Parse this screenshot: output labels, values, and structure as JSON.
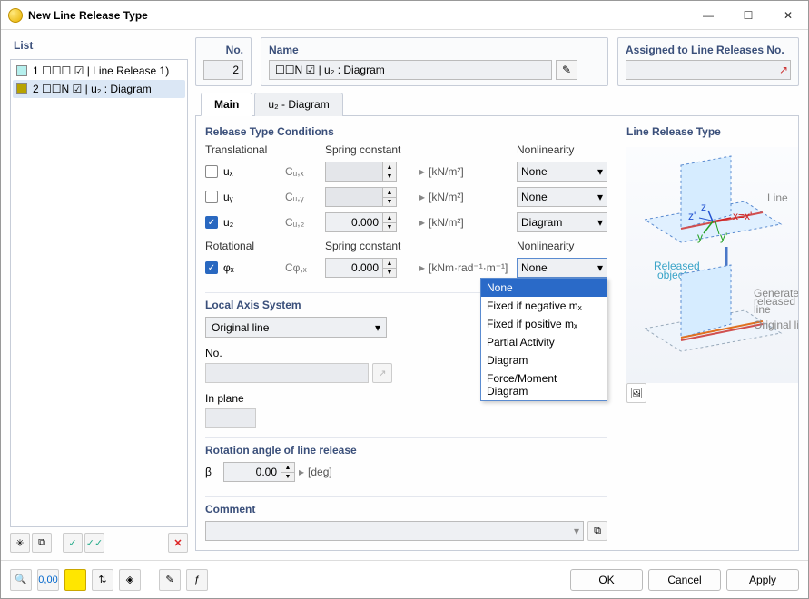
{
  "window_title": "New Line Release Type",
  "list": {
    "header": "List",
    "items": [
      {
        "swatch": "#b6f0ee",
        "label": "1  ☐☐☐ ☑ | Line Release 1)"
      },
      {
        "swatch": "#b8a300",
        "label": "2  ☐☐N ☑ | u₂ : Diagram"
      }
    ],
    "selected_index": 1
  },
  "top": {
    "no_label": "No.",
    "no_value": "2",
    "name_label": "Name",
    "name_value": "☐☐N ☑ | u₂ : Diagram",
    "assigned_label": "Assigned to Line Releases No."
  },
  "tabs": {
    "items": [
      "Main",
      "u₂ - Diagram"
    ],
    "active_index": 0
  },
  "conditions": {
    "header": "Release Type Conditions",
    "translational_label": "Translational",
    "spring_label": "Spring constant",
    "nonlinearity_label": "Nonlinearity",
    "rows_t": [
      {
        "chk": false,
        "name": "uₓ",
        "slabel": "Cᵤ,ₓ",
        "val": "",
        "unit": "[kN/m²]",
        "nl": "None"
      },
      {
        "chk": false,
        "name": "uᵧ",
        "slabel": "Cᵤ,ᵧ",
        "val": "",
        "unit": "[kN/m²]",
        "nl": "None"
      },
      {
        "chk": true,
        "name": "u₂",
        "slabel": "Cᵤ,₂",
        "val": "0.000",
        "unit": "[kN/m²]",
        "nl": "Diagram"
      }
    ],
    "rotational_label": "Rotational",
    "rows_r": [
      {
        "chk": true,
        "name": "φₓ",
        "slabel": "Cφ,ₓ",
        "val": "0.000",
        "unit": "[kNm·rad⁻¹·m⁻¹]",
        "nl": "None"
      }
    ]
  },
  "dropdown": {
    "items": [
      "None",
      "Fixed if negative mₓ",
      "Fixed if positive mₓ",
      "Partial Activity",
      "Diagram",
      "Force/Moment Diagram"
    ],
    "selected_index": 0
  },
  "local": {
    "header": "Local Axis System",
    "select_value": "Original line",
    "no_label": "No.",
    "inplane_label": "In plane"
  },
  "rotation": {
    "header": "Rotation angle of line release",
    "symbol": "β",
    "value": "0.00",
    "unit": "[deg]"
  },
  "comment_label": "Comment",
  "right_panel_header": "Line Release Type",
  "diagram_labels": {
    "line": "Line",
    "released": "Released objects",
    "generated": "Generated released line",
    "original": "Original line"
  },
  "footer": {
    "ok": "OK",
    "cancel": "Cancel",
    "apply": "Apply"
  }
}
